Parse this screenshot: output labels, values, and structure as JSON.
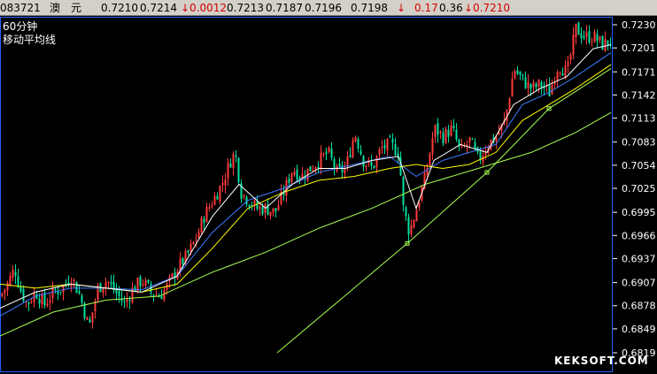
{
  "quote_bar": {
    "code": "083721",
    "name": "澳　元",
    "price": "0.7210",
    "ask": "0.7214",
    "change": "↓0.0012",
    "prev_close": "0.7213",
    "open": "0.7187",
    "low": "0.7196",
    "bid": "0.7198",
    "arrow": "↓",
    "change_pct": "0.17",
    "amplitude": "0.36",
    "last": "↓0.7210"
  },
  "chart_panel": {
    "period_label": "60分钟",
    "indicator_label": "移动平均线",
    "watermark": "KEKSOFT.COM"
  },
  "colors": {
    "background": "#000000",
    "frame": "#1e64ff",
    "axis_text": "#ffffff",
    "candle_up": "#ff3a3a",
    "candle_down": "#00e0a0",
    "ma_short": "#ffffff",
    "ma_mid": "#ffff00",
    "ma_blue": "#3a7bff",
    "ma_long": "#a8ff50",
    "trendline": "#a8ff50"
  },
  "chart_data": {
    "type": "candlestick",
    "y_ticks": [
      "0.7230",
      "0.7201",
      "0.7171",
      "0.7142",
      "0.7113",
      "0.7083",
      "0.7054",
      "0.7025",
      "0.6995",
      "0.6966",
      "0.6937",
      "0.6907",
      "0.6878",
      "0.6849",
      "0.6819"
    ],
    "ylim": [
      0.6819,
      0.723
    ],
    "close_path": [
      [
        0,
        0.689
      ],
      [
        8,
        0.6905
      ],
      [
        16,
        0.6925
      ],
      [
        22,
        0.69
      ],
      [
        30,
        0.688
      ],
      [
        40,
        0.6895
      ],
      [
        50,
        0.688
      ],
      [
        60,
        0.6895
      ],
      [
        70,
        0.69
      ],
      [
        80,
        0.6915
      ],
      [
        90,
        0.689
      ],
      [
        100,
        0.685
      ],
      [
        110,
        0.69
      ],
      [
        120,
        0.691
      ],
      [
        130,
        0.6895
      ],
      [
        140,
        0.688
      ],
      [
        150,
        0.69
      ],
      [
        160,
        0.691
      ],
      [
        170,
        0.6895
      ],
      [
        180,
        0.689
      ],
      [
        190,
        0.6905
      ],
      [
        200,
        0.6925
      ],
      [
        210,
        0.694
      ],
      [
        220,
        0.696
      ],
      [
        230,
        0.699
      ],
      [
        240,
        0.701
      ],
      [
        250,
        0.703
      ],
      [
        260,
        0.706
      ],
      [
        265,
        0.707
      ],
      [
        272,
        0.702
      ],
      [
        280,
        0.701
      ],
      [
        290,
        0.7
      ],
      [
        300,
        0.7
      ],
      [
        310,
        0.6995
      ],
      [
        320,
        0.702
      ],
      [
        330,
        0.705
      ],
      [
        340,
        0.704
      ],
      [
        350,
        0.705
      ],
      [
        360,
        0.706
      ],
      [
        370,
        0.707
      ],
      [
        380,
        0.7045
      ],
      [
        390,
        0.705
      ],
      [
        400,
        0.7095
      ],
      [
        410,
        0.706
      ],
      [
        420,
        0.705
      ],
      [
        430,
        0.7075
      ],
      [
        440,
        0.708
      ],
      [
        450,
        0.707
      ],
      [
        455,
        0.7
      ],
      [
        462,
        0.697
      ],
      [
        470,
        0.7
      ],
      [
        480,
        0.704
      ],
      [
        490,
        0.71
      ],
      [
        500,
        0.709
      ],
      [
        510,
        0.71
      ],
      [
        520,
        0.707
      ],
      [
        530,
        0.7085
      ],
      [
        540,
        0.706
      ],
      [
        550,
        0.708
      ],
      [
        560,
        0.709
      ],
      [
        570,
        0.711
      ],
      [
        580,
        0.7175
      ],
      [
        590,
        0.716
      ],
      [
        600,
        0.715
      ],
      [
        610,
        0.7155
      ],
      [
        620,
        0.7145
      ],
      [
        630,
        0.718
      ],
      [
        640,
        0.717
      ],
      [
        650,
        0.7225
      ],
      [
        660,
        0.7215
      ],
      [
        670,
        0.7215
      ],
      [
        680,
        0.7205
      ],
      [
        690,
        0.721
      ]
    ],
    "ma_short": [
      [
        0,
        0.6875
      ],
      [
        40,
        0.6895
      ],
      [
        80,
        0.6905
      ],
      [
        120,
        0.69
      ],
      [
        160,
        0.6895
      ],
      [
        200,
        0.6915
      ],
      [
        240,
        0.699
      ],
      [
        270,
        0.703
      ],
      [
        300,
        0.7
      ],
      [
        330,
        0.703
      ],
      [
        360,
        0.705
      ],
      [
        390,
        0.705
      ],
      [
        420,
        0.706
      ],
      [
        450,
        0.7065
      ],
      [
        470,
        0.7
      ],
      [
        490,
        0.706
      ],
      [
        520,
        0.708
      ],
      [
        550,
        0.707
      ],
      [
        580,
        0.713
      ],
      [
        610,
        0.715
      ],
      [
        640,
        0.7165
      ],
      [
        670,
        0.72
      ],
      [
        690,
        0.7205
      ]
    ],
    "ma_mid": [
      [
        0,
        0.6905
      ],
      [
        40,
        0.69
      ],
      [
        80,
        0.6905
      ],
      [
        120,
        0.69
      ],
      [
        160,
        0.6895
      ],
      [
        200,
        0.6905
      ],
      [
        240,
        0.695
      ],
      [
        280,
        0.7
      ],
      [
        320,
        0.702
      ],
      [
        360,
        0.7035
      ],
      [
        400,
        0.704
      ],
      [
        440,
        0.705
      ],
      [
        470,
        0.7055
      ],
      [
        500,
        0.705
      ],
      [
        530,
        0.7055
      ],
      [
        560,
        0.707
      ],
      [
        590,
        0.711
      ],
      [
        620,
        0.713
      ],
      [
        650,
        0.715
      ],
      [
        690,
        0.718
      ]
    ],
    "ma_blue": [
      [
        0,
        0.6865
      ],
      [
        40,
        0.689
      ],
      [
        80,
        0.69
      ],
      [
        120,
        0.69
      ],
      [
        160,
        0.6898
      ],
      [
        200,
        0.6915
      ],
      [
        240,
        0.697
      ],
      [
        280,
        0.701
      ],
      [
        320,
        0.7025
      ],
      [
        360,
        0.7045
      ],
      [
        400,
        0.7055
      ],
      [
        440,
        0.7065
      ],
      [
        470,
        0.704
      ],
      [
        500,
        0.706
      ],
      [
        530,
        0.707
      ],
      [
        560,
        0.708
      ],
      [
        590,
        0.713
      ],
      [
        620,
        0.7145
      ],
      [
        650,
        0.7165
      ],
      [
        690,
        0.7195
      ]
    ],
    "ma_long": [
      [
        0,
        0.684
      ],
      [
        60,
        0.687
      ],
      [
        120,
        0.6885
      ],
      [
        180,
        0.689
      ],
      [
        240,
        0.692
      ],
      [
        300,
        0.6945
      ],
      [
        360,
        0.6975
      ],
      [
        420,
        0.7
      ],
      [
        480,
        0.703
      ],
      [
        540,
        0.705
      ],
      [
        600,
        0.707
      ],
      [
        650,
        0.7095
      ],
      [
        690,
        0.712
      ]
    ],
    "trendlines": [
      [
        [
          313,
          0.6819
        ],
        [
          460,
          0.6956
        ],
        [
          550,
          0.7045
        ],
        [
          620,
          0.7125
        ],
        [
          690,
          0.7175
        ]
      ]
    ]
  }
}
